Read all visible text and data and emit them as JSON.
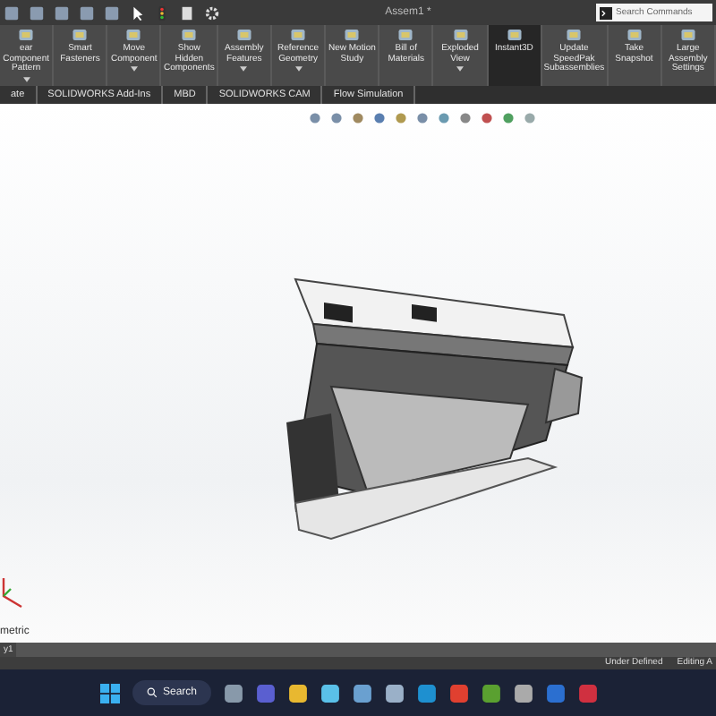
{
  "window": {
    "title": "Assem1 *"
  },
  "search": {
    "placeholder": "Search Commands"
  },
  "commands": [
    {
      "label": "ear Component Pattern",
      "dropdown": true,
      "active": false
    },
    {
      "label": "Smart Fasteners",
      "dropdown": false,
      "active": false
    },
    {
      "label": "Move Component",
      "dropdown": true,
      "active": false
    },
    {
      "label": "Show Hidden Components",
      "dropdown": false,
      "active": false
    },
    {
      "label": "Assembly Features",
      "dropdown": true,
      "active": false
    },
    {
      "label": "Reference Geometry",
      "dropdown": true,
      "active": false
    },
    {
      "label": "New Motion Study",
      "dropdown": false,
      "active": false
    },
    {
      "label": "Bill of Materials",
      "dropdown": false,
      "active": false
    },
    {
      "label": "Exploded View",
      "dropdown": true,
      "active": false
    },
    {
      "label": "Instant3D",
      "dropdown": false,
      "active": true
    },
    {
      "label": "Update SpeedPak Subassemblies",
      "dropdown": false,
      "active": false
    },
    {
      "label": "Take Snapshot",
      "dropdown": false,
      "active": false
    },
    {
      "label": "Large Assembly Settings",
      "dropdown": false,
      "active": false
    }
  ],
  "tabs": [
    {
      "label": "ate",
      "selected": false
    },
    {
      "label": "SOLIDWORKS Add-Ins",
      "selected": false
    },
    {
      "label": "MBD",
      "selected": false
    },
    {
      "label": "SOLIDWORKS CAM",
      "selected": false
    },
    {
      "label": "Flow Simulation",
      "selected": false
    }
  ],
  "viewport": {
    "view_label": "metric"
  },
  "model_tab": "y1",
  "status_bar": [
    "Under Defined",
    "Editing A"
  ],
  "taskbar": {
    "search_label": "Search"
  }
}
